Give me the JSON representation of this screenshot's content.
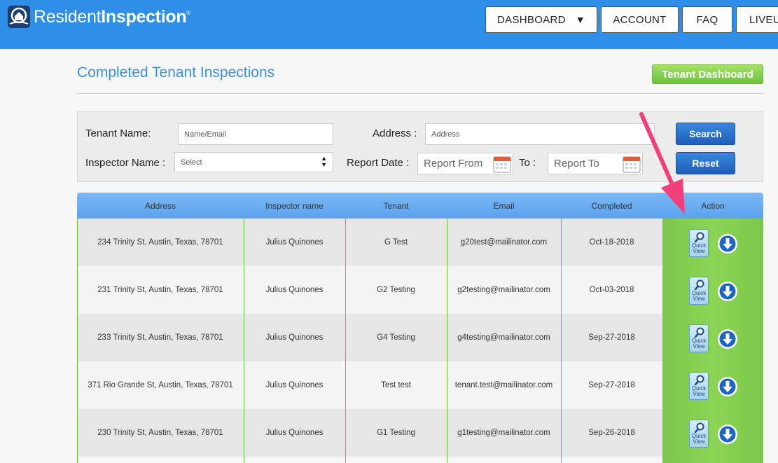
{
  "header": {
    "logo": {
      "word1": "Resident",
      "word2": "Inspection",
      "mark": "®"
    },
    "nav": [
      {
        "label": "DASHBOARD",
        "caret": "▼"
      },
      {
        "label": "ACCOUNT"
      },
      {
        "label": "FAQ"
      },
      {
        "label": "LIVEU"
      }
    ]
  },
  "page": {
    "title": "Completed Tenant Inspections",
    "dashboard_button": "Tenant Dashboard"
  },
  "search": {
    "tenant_label": "Tenant Name:",
    "tenant_placeholder": "Name/Email",
    "address_label": "Address :",
    "address_placeholder": "Address",
    "inspector_label": "Inspector Name :",
    "inspector_value": "Select",
    "report_date_label": "Report Date :",
    "report_from_placeholder": "Report From",
    "to_label": "To :",
    "report_to_placeholder": "Report To",
    "search_button": "Search",
    "reset_button": "Reset"
  },
  "table": {
    "headers": [
      "Address",
      "Inspector name",
      "Tenant",
      "Email",
      "Completed",
      "Action"
    ],
    "quick_view_text": [
      "Quick",
      "View"
    ],
    "rows": [
      {
        "address": "234 Trinity St, Austin, Texas, 78701",
        "inspector": "Julius Quinones",
        "tenant": "G Test",
        "email": "g20test@mailinator.com",
        "completed": "Oct-18-2018"
      },
      {
        "address": "231 Trinity St, Austin, Texas, 78701",
        "inspector": "Julius Quinones",
        "tenant": "G2 Testing",
        "email": "g2testing@mailinator.com",
        "completed": "Oct-03-2018"
      },
      {
        "address": "233 Trinity St, Austin, Texas, 78701",
        "inspector": "Julius Quinones",
        "tenant": "G4 Testing",
        "email": "g4testing@mailinator.com",
        "completed": "Sep-27-2018"
      },
      {
        "address": "371 Rio Grande St, Austin, Texas, 78701",
        "inspector": "Julius Quinones",
        "tenant": "Test test",
        "email": "tenant.test@mailinator.com",
        "completed": "Sep-27-2018"
      },
      {
        "address": "230 Trinity St, Austin, Texas, 78701",
        "inspector": "Julius Quinones",
        "tenant": "G1 Testing",
        "email": "g1testing@mailinator.com",
        "completed": "Sep-26-2018"
      }
    ]
  },
  "colors": {
    "header_blue": "#2f8fe6",
    "title_blue": "#3d8fd9",
    "action_green": "#7cc84a",
    "annotation_pink": "#f0407a"
  },
  "icons": [
    "logo-house-icon",
    "calendar-icon",
    "select-arrows-icon",
    "quick-view-icon",
    "download-icon",
    "annotation-arrow"
  ]
}
